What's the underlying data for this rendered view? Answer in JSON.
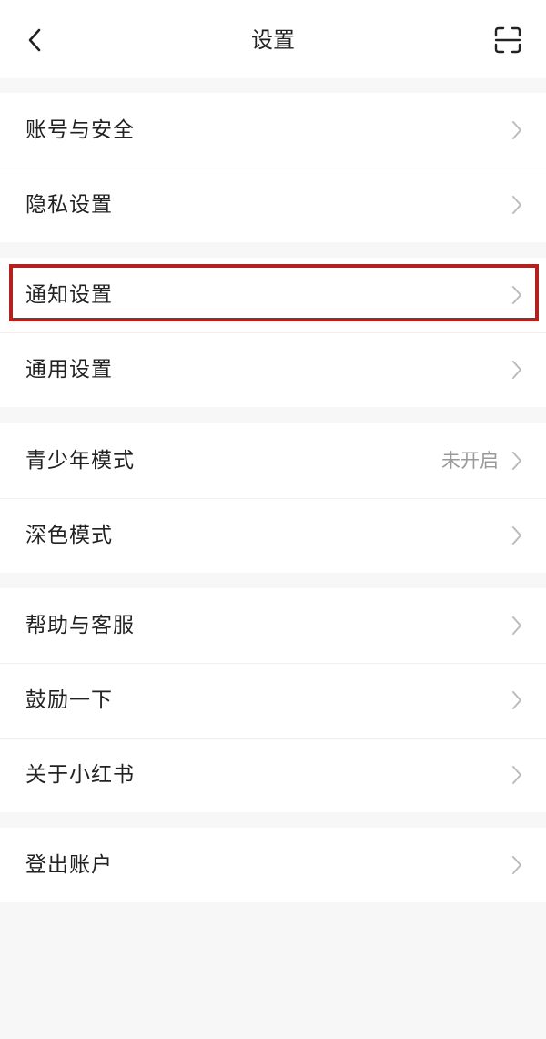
{
  "header": {
    "title": "设置",
    "back_icon": "chevron-left-icon",
    "scan_icon": "scan-icon"
  },
  "groups": [
    {
      "items": [
        {
          "label": "账号与安全",
          "value": ""
        },
        {
          "label": "隐私设置",
          "value": ""
        }
      ]
    },
    {
      "items": [
        {
          "label": "通知设置",
          "value": ""
        },
        {
          "label": "通用设置",
          "value": ""
        }
      ]
    },
    {
      "items": [
        {
          "label": "青少年模式",
          "value": "未开启"
        },
        {
          "label": "深色模式",
          "value": ""
        }
      ]
    },
    {
      "items": [
        {
          "label": "帮助与客服",
          "value": ""
        },
        {
          "label": "鼓励一下",
          "value": ""
        },
        {
          "label": "关于小红书",
          "value": ""
        }
      ]
    },
    {
      "items": [
        {
          "label": "登出账户",
          "value": ""
        }
      ]
    }
  ],
  "colors": {
    "background": "#f7f7f7",
    "row_background": "#ffffff",
    "text": "#222222",
    "secondary_text": "#999999",
    "chevron": "#bbbbbb",
    "highlight": "#b3211e"
  }
}
